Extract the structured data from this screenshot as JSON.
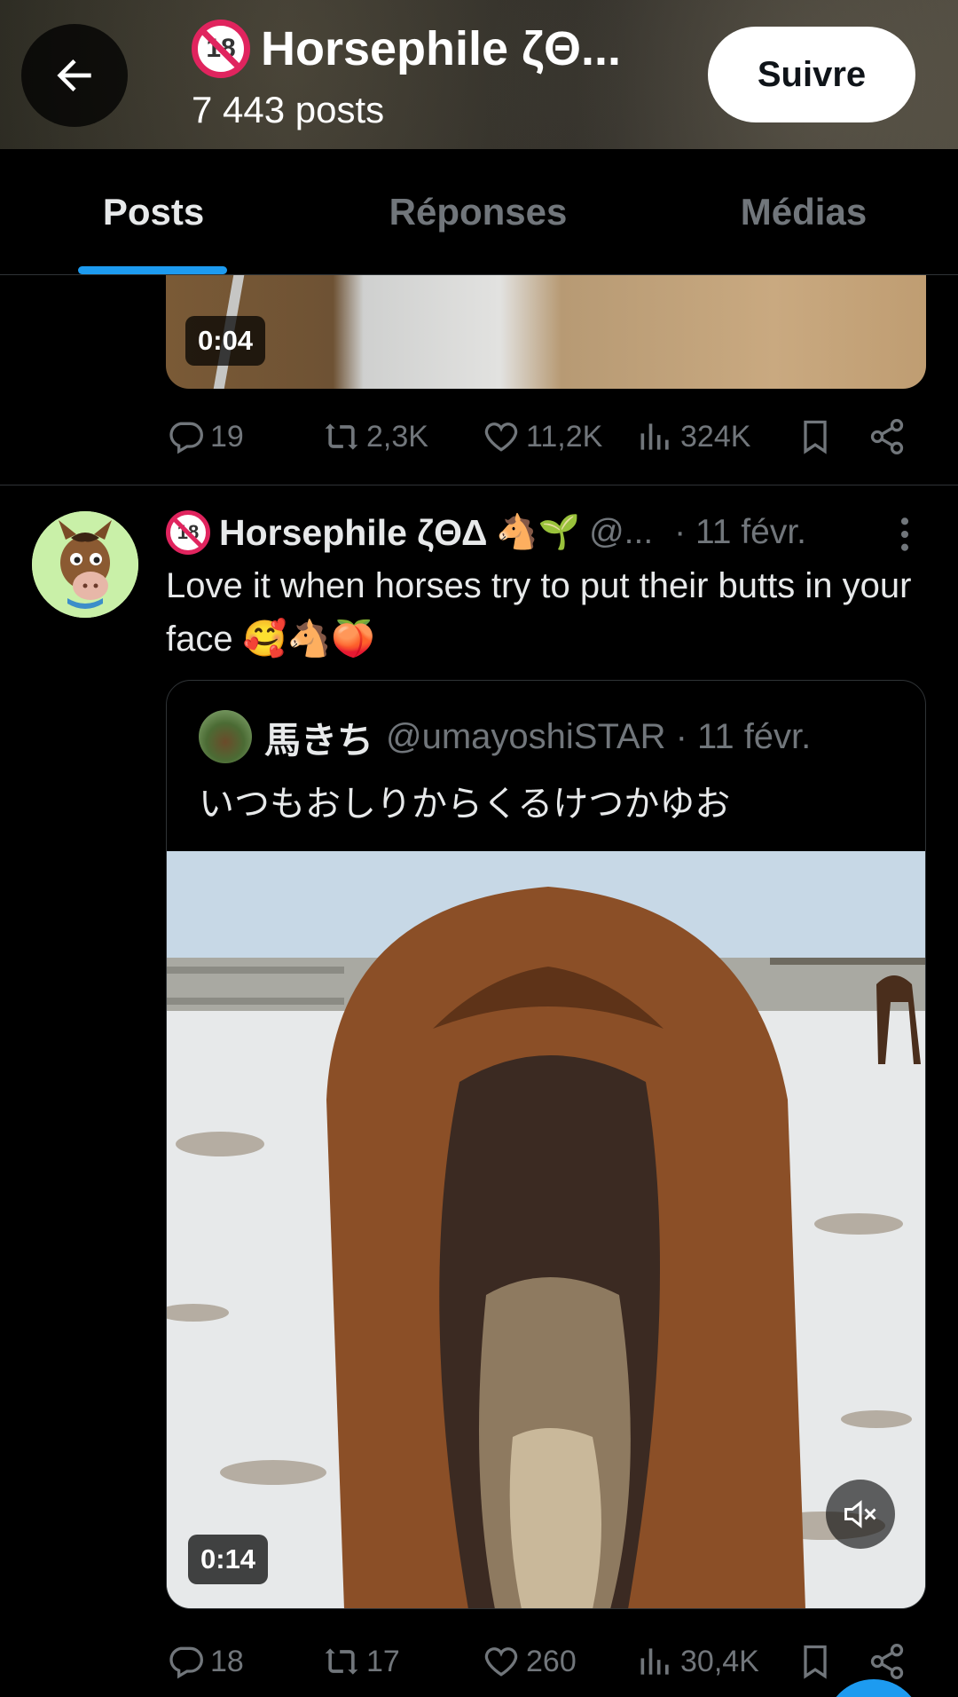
{
  "header": {
    "title": "Horsephile ζΘ...",
    "post_count": "7 443 posts",
    "follow_label": "Suivre",
    "badge": "18"
  },
  "tabs": [
    {
      "label": "Posts",
      "active": true
    },
    {
      "label": "Réponses",
      "active": false
    },
    {
      "label": "Médias",
      "active": false
    }
  ],
  "post1": {
    "video_duration": "0:04",
    "replies": "19",
    "reposts": "2,3K",
    "likes": "11,2K",
    "views": "324K"
  },
  "post2": {
    "author_name": "Horsephile ζΘΔ",
    "author_emojis": "🐴🌱",
    "handle": "@...",
    "date": "· 11 févr.",
    "text": "Love it when horses try to put their butts in your face 🥰🐴🍑",
    "quote": {
      "author_name": "馬きち",
      "meta": "@umayoshiSTAR · 11 févr.",
      "text": "いつもおしりからくるけつかゆお",
      "video_duration": "0:14"
    },
    "replies": "18",
    "reposts": "17",
    "likes": "260",
    "views": "30,4K"
  },
  "icons": {
    "back": "arrow-left-icon",
    "reply": "speech-bubble-icon",
    "repost": "repost-arrows-icon",
    "like": "heart-icon",
    "views": "bar-chart-icon",
    "bookmark": "bookmark-icon",
    "share": "share-icon",
    "more": "vertical-dots-icon",
    "mute": "speaker-muted-icon"
  },
  "colors": {
    "accent": "#1d9bf0",
    "muted_text": "#71767b",
    "badge_red": "#e0245e"
  }
}
